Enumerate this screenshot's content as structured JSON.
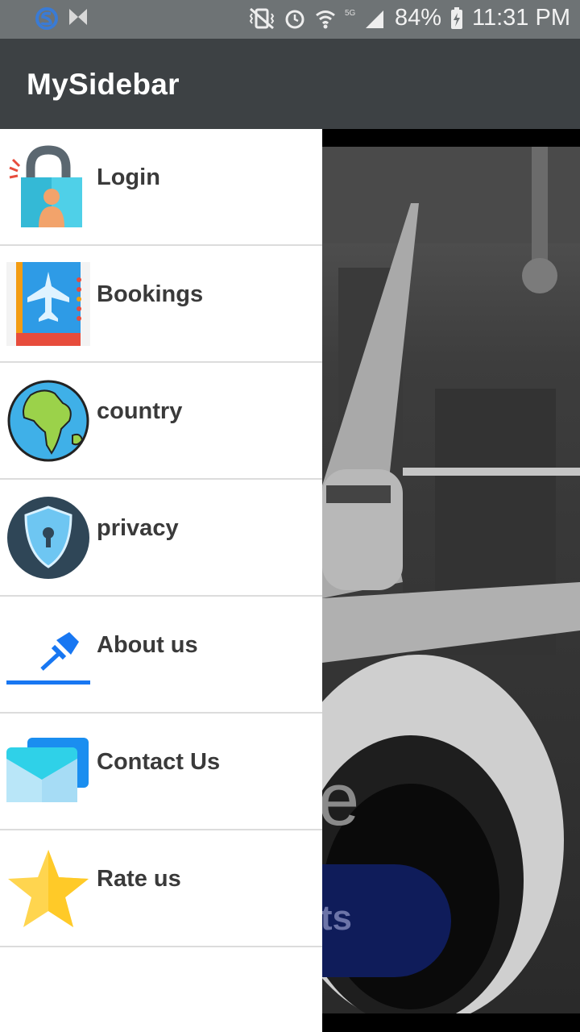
{
  "status_bar": {
    "battery": "84%",
    "time": "11:31 PM",
    "icons": [
      "s-app-icon",
      "bowtie-icon",
      "vibrate-icon",
      "alarm-icon",
      "wifi-icon",
      "signal-icon",
      "battery-icon"
    ]
  },
  "app_bar": {
    "title": "MySidebar"
  },
  "drawer": {
    "items": [
      {
        "label": "Login",
        "icon": "lock-user-icon"
      },
      {
        "label": "Bookings",
        "icon": "plane-booklet-icon"
      },
      {
        "label": "country",
        "icon": "globe-icon"
      },
      {
        "label": "privacy",
        "icon": "shield-icon"
      },
      {
        "label": "About us",
        "icon": "pin-icon"
      },
      {
        "label": "Contact Us",
        "icon": "mail-icon"
      },
      {
        "label": "Rate us",
        "icon": "star-icon"
      }
    ]
  },
  "background": {
    "partial_text": "e",
    "partial_button_label": "ts"
  }
}
